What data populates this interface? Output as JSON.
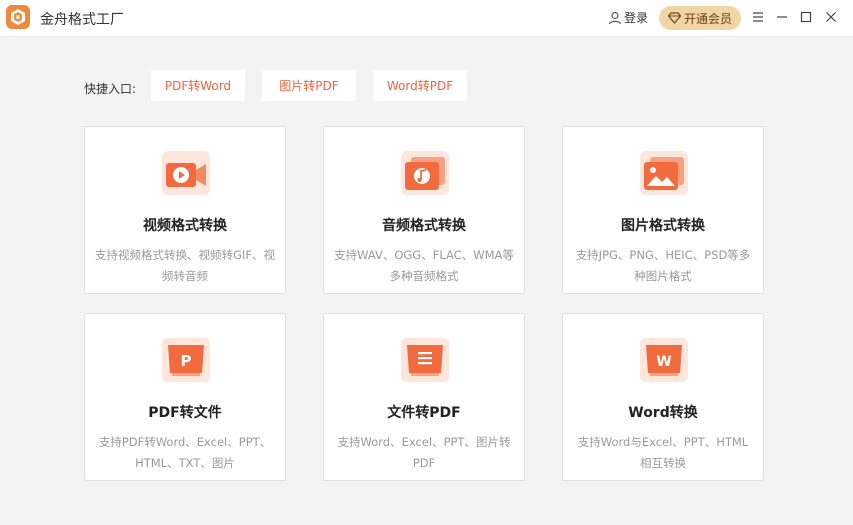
{
  "window": {
    "app_title": "金舟格式工厂",
    "login_label": "登录",
    "vip_label": "开通会员",
    "colors": {
      "accent": "#f0633b",
      "vip_bg": "#f2d5a6"
    }
  },
  "quick_entry": {
    "label": "快捷入口:",
    "buttons": [
      "PDF转Word",
      "图片转PDF",
      "Word转PDF"
    ]
  },
  "cards": [
    {
      "title": "视频格式转换",
      "desc": "支持视频格式转换、视频转GIF、视频转音频",
      "icon": "video-camera-icon"
    },
    {
      "title": "音频格式转换",
      "desc": "支持WAV、OGG、FLAC、WMA等多种音频格式",
      "icon": "music-note-icon"
    },
    {
      "title": "图片格式转换",
      "desc": "支持JPG、PNG、HEIC、PSD等多种图片格式",
      "icon": "picture-icon"
    },
    {
      "title": "PDF转文件",
      "desc": "支持PDF转Word、Excel、PPT、HTML、TXT、图片",
      "icon": "pdf-p-icon"
    },
    {
      "title": "文件转PDF",
      "desc": "支持Word、Excel、PPT、图片转PDF",
      "icon": "document-icon"
    },
    {
      "title": "Word转换",
      "desc": "支持Word与Excel、PPT、HTML相互转换",
      "icon": "word-w-icon"
    }
  ]
}
